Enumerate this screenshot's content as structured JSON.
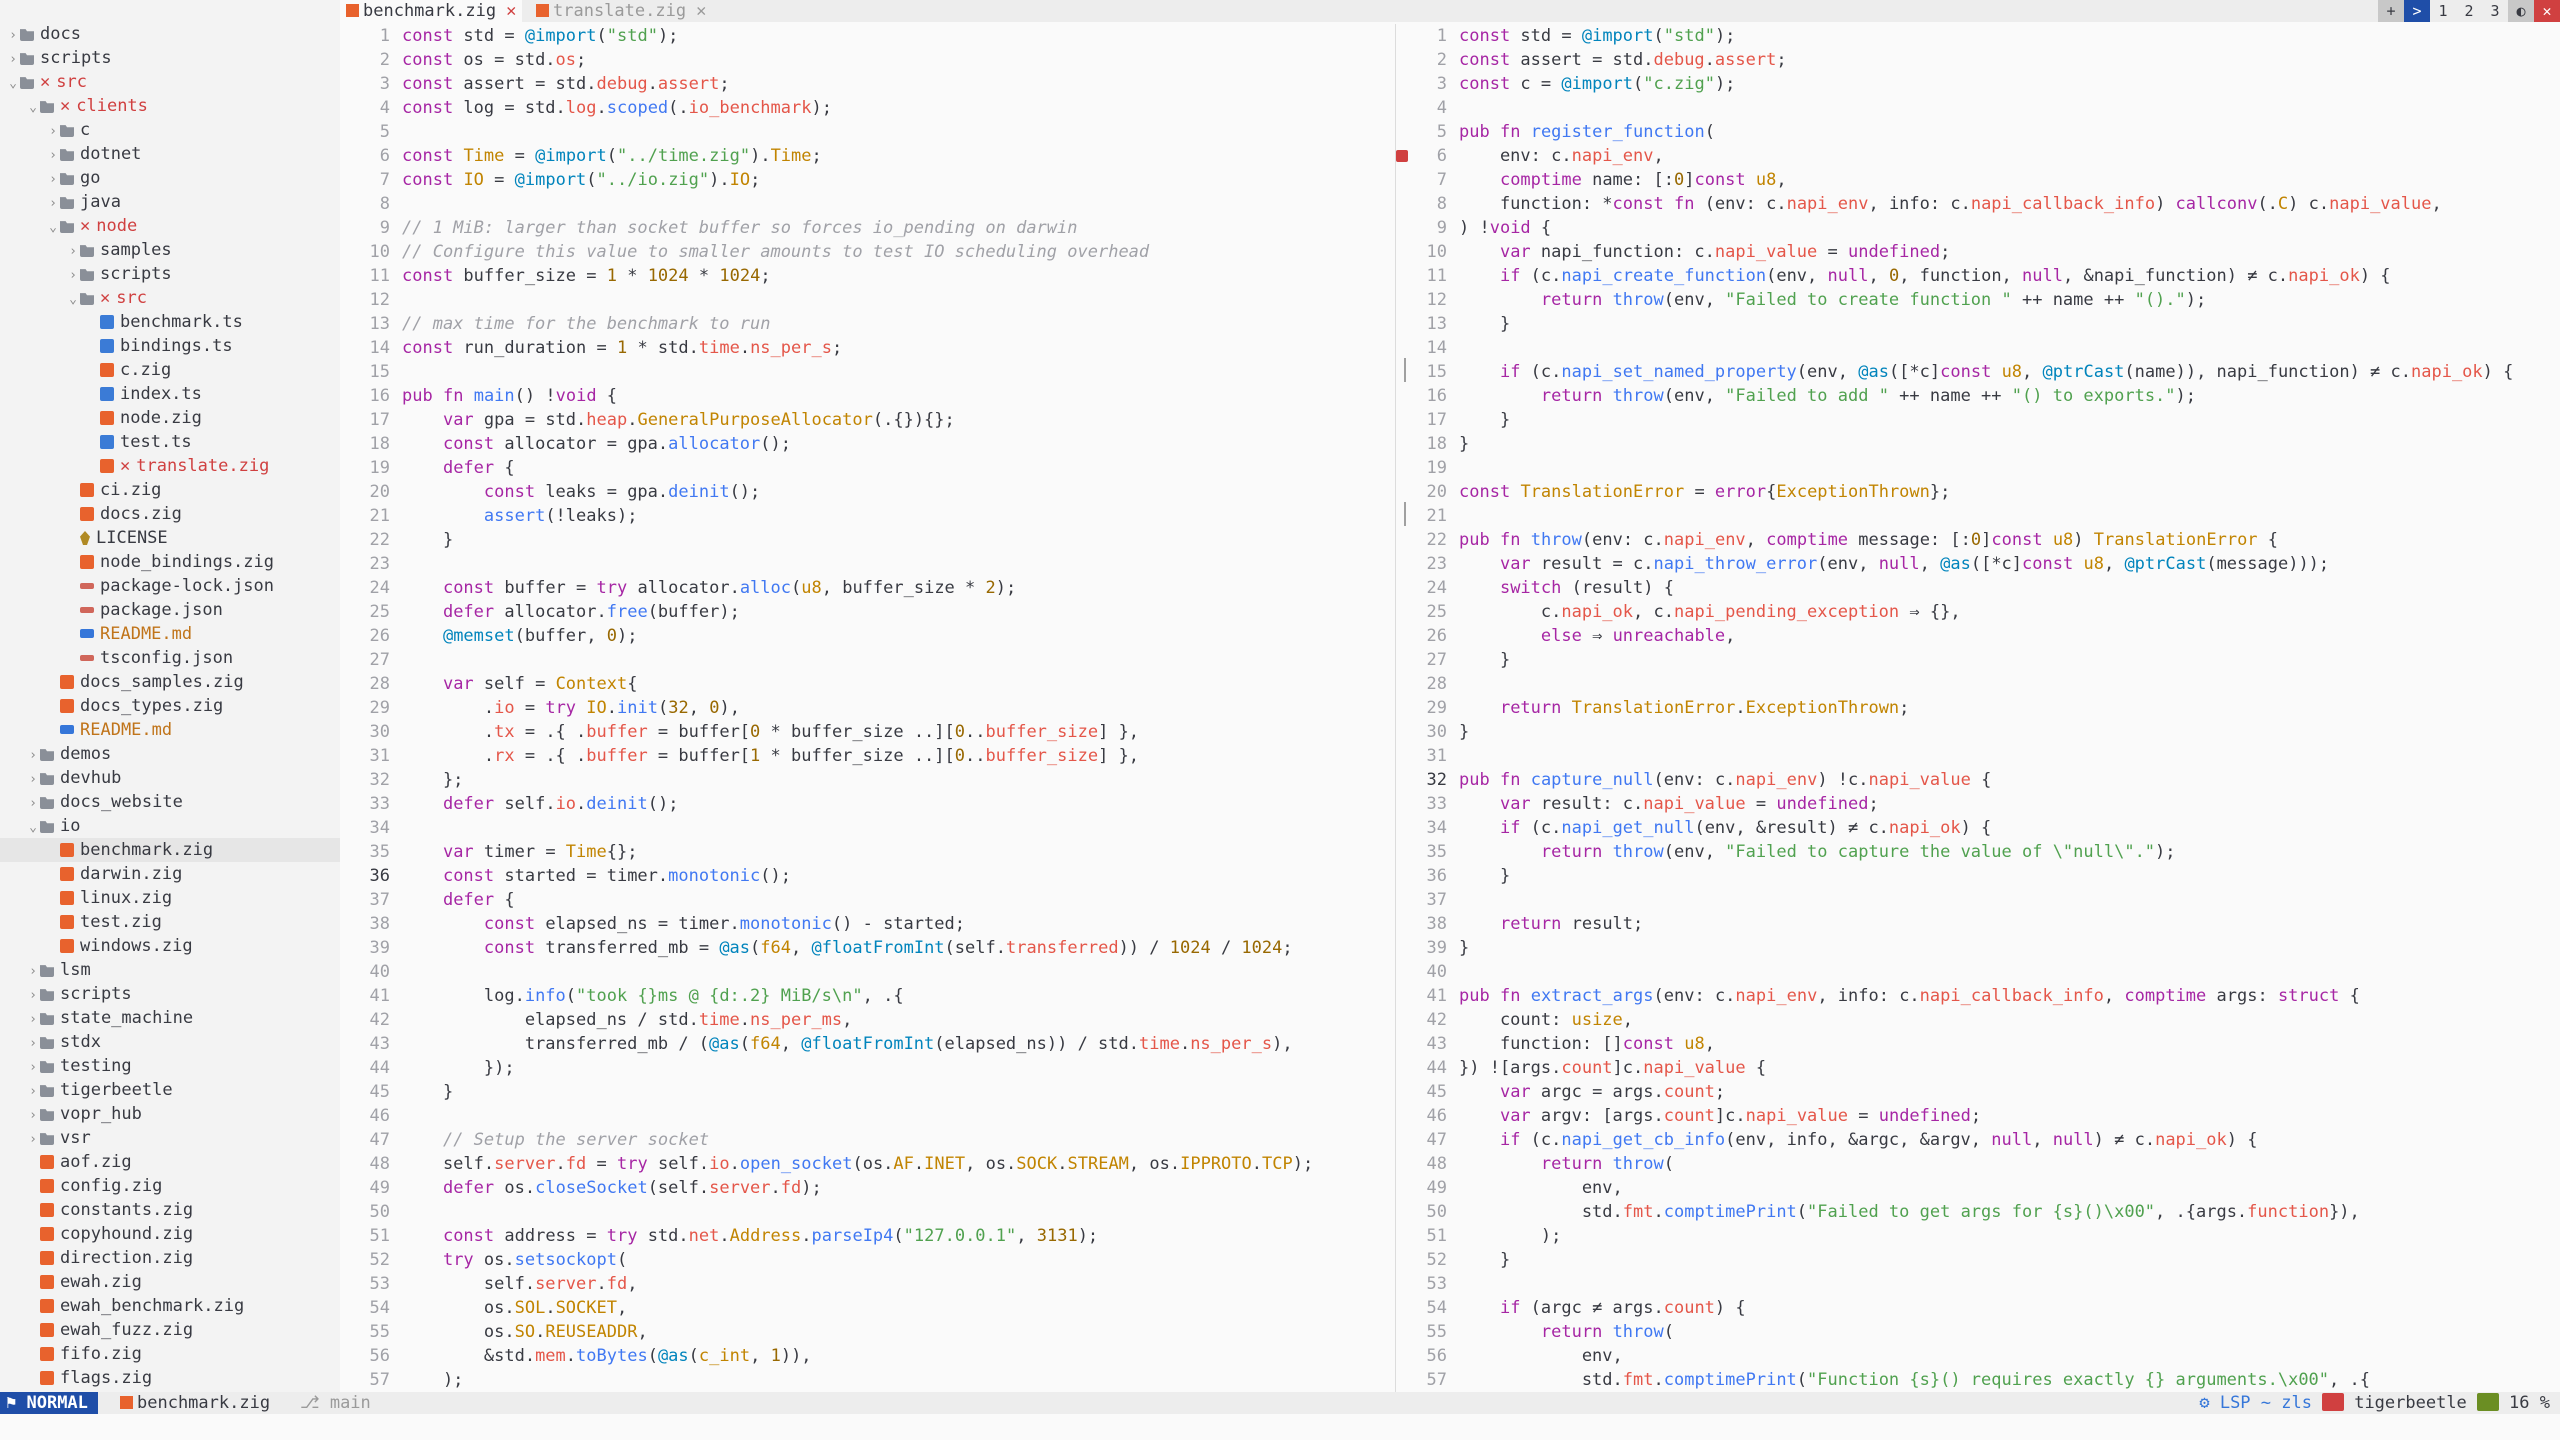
{
  "tabs": [
    {
      "label": "benchmark.zig",
      "active": true
    },
    {
      "label": "translate.zig",
      "active": false
    }
  ],
  "tab_controls": [
    "+",
    ">",
    "1",
    "2",
    "3",
    "◐",
    "✕"
  ],
  "sidebar": [
    {
      "label": "docs",
      "depth": 0,
      "kind": "folder",
      "open": false
    },
    {
      "label": "scripts",
      "depth": 0,
      "kind": "folder",
      "open": false
    },
    {
      "label": "src",
      "depth": 0,
      "kind": "folder",
      "open": true,
      "state": "err"
    },
    {
      "label": "clients",
      "depth": 1,
      "kind": "folder",
      "open": true,
      "state": "err"
    },
    {
      "label": "c",
      "depth": 2,
      "kind": "folder",
      "open": false
    },
    {
      "label": "dotnet",
      "depth": 2,
      "kind": "folder",
      "open": false
    },
    {
      "label": "go",
      "depth": 2,
      "kind": "folder",
      "open": false
    },
    {
      "label": "java",
      "depth": 2,
      "kind": "folder",
      "open": false
    },
    {
      "label": "node",
      "depth": 2,
      "kind": "folder",
      "open": true,
      "state": "err"
    },
    {
      "label": "samples",
      "depth": 3,
      "kind": "folder",
      "open": false
    },
    {
      "label": "scripts",
      "depth": 3,
      "kind": "folder",
      "open": false
    },
    {
      "label": "src",
      "depth": 3,
      "kind": "folder",
      "open": true,
      "state": "err"
    },
    {
      "label": "benchmark.ts",
      "depth": 4,
      "kind": "ts"
    },
    {
      "label": "bindings.ts",
      "depth": 4,
      "kind": "ts"
    },
    {
      "label": "c.zig",
      "depth": 4,
      "kind": "zig"
    },
    {
      "label": "index.ts",
      "depth": 4,
      "kind": "ts"
    },
    {
      "label": "node.zig",
      "depth": 4,
      "kind": "zig"
    },
    {
      "label": "test.ts",
      "depth": 4,
      "kind": "ts"
    },
    {
      "label": "translate.zig",
      "depth": 4,
      "kind": "zig",
      "state": "err"
    },
    {
      "label": "ci.zig",
      "depth": 3,
      "kind": "zig"
    },
    {
      "label": "docs.zig",
      "depth": 3,
      "kind": "zig"
    },
    {
      "label": "LICENSE",
      "depth": 3,
      "kind": "lic"
    },
    {
      "label": "node_bindings.zig",
      "depth": 3,
      "kind": "zig"
    },
    {
      "label": "package-lock.json",
      "depth": 3,
      "kind": "json"
    },
    {
      "label": "package.json",
      "depth": 3,
      "kind": "json"
    },
    {
      "label": "README.md",
      "depth": 3,
      "kind": "md",
      "state": "warn"
    },
    {
      "label": "tsconfig.json",
      "depth": 3,
      "kind": "json"
    },
    {
      "label": "docs_samples.zig",
      "depth": 2,
      "kind": "zig"
    },
    {
      "label": "docs_types.zig",
      "depth": 2,
      "kind": "zig"
    },
    {
      "label": "README.md",
      "depth": 2,
      "kind": "md",
      "state": "warn"
    },
    {
      "label": "demos",
      "depth": 1,
      "kind": "folder",
      "open": false
    },
    {
      "label": "devhub",
      "depth": 1,
      "kind": "folder",
      "open": false
    },
    {
      "label": "docs_website",
      "depth": 1,
      "kind": "folder",
      "open": false
    },
    {
      "label": "io",
      "depth": 1,
      "kind": "folder",
      "open": true
    },
    {
      "label": "benchmark.zig",
      "depth": 2,
      "kind": "zig",
      "active": true
    },
    {
      "label": "darwin.zig",
      "depth": 2,
      "kind": "zig"
    },
    {
      "label": "linux.zig",
      "depth": 2,
      "kind": "zig"
    },
    {
      "label": "test.zig",
      "depth": 2,
      "kind": "zig"
    },
    {
      "label": "windows.zig",
      "depth": 2,
      "kind": "zig"
    },
    {
      "label": "lsm",
      "depth": 1,
      "kind": "folder",
      "open": false
    },
    {
      "label": "scripts",
      "depth": 1,
      "kind": "folder",
      "open": false
    },
    {
      "label": "state_machine",
      "depth": 1,
      "kind": "folder",
      "open": false
    },
    {
      "label": "stdx",
      "depth": 1,
      "kind": "folder",
      "open": false
    },
    {
      "label": "testing",
      "depth": 1,
      "kind": "folder",
      "open": false
    },
    {
      "label": "tigerbeetle",
      "depth": 1,
      "kind": "folder",
      "open": false
    },
    {
      "label": "vopr_hub",
      "depth": 1,
      "kind": "folder",
      "open": false
    },
    {
      "label": "vsr",
      "depth": 1,
      "kind": "folder",
      "open": false
    },
    {
      "label": "aof.zig",
      "depth": 1,
      "kind": "zig"
    },
    {
      "label": "config.zig",
      "depth": 1,
      "kind": "zig"
    },
    {
      "label": "constants.zig",
      "depth": 1,
      "kind": "zig"
    },
    {
      "label": "copyhound.zig",
      "depth": 1,
      "kind": "zig"
    },
    {
      "label": "direction.zig",
      "depth": 1,
      "kind": "zig"
    },
    {
      "label": "ewah.zig",
      "depth": 1,
      "kind": "zig"
    },
    {
      "label": "ewah_benchmark.zig",
      "depth": 1,
      "kind": "zig"
    },
    {
      "label": "ewah_fuzz.zig",
      "depth": 1,
      "kind": "zig"
    },
    {
      "label": "fifo.zig",
      "depth": 1,
      "kind": "zig"
    },
    {
      "label": "flags.zig",
      "depth": 1,
      "kind": "zig"
    }
  ],
  "left_editor": {
    "current_line": 36,
    "lines": [
      "const std = @import(\"std\");",
      "const os = std.os;",
      "const assert = std.debug.assert;",
      "const log = std.log.scoped(.io_benchmark);",
      "",
      "const Time = @import(\"../time.zig\").Time;",
      "const IO = @import(\"../io.zig\").IO;",
      "",
      "// 1 MiB: larger than socket buffer so forces io_pending on darwin",
      "// Configure this value to smaller amounts to test IO scheduling overhead",
      "const buffer_size = 1 * 1024 * 1024;",
      "",
      "// max time for the benchmark to run",
      "const run_duration = 1 * std.time.ns_per_s;",
      "",
      "pub fn main() !void {",
      "    var gpa = std.heap.GeneralPurposeAllocator(.{}){};",
      "    const allocator = gpa.allocator();",
      "    defer {",
      "        const leaks = gpa.deinit();",
      "        assert(!leaks);",
      "    }",
      "",
      "    const buffer = try allocator.alloc(u8, buffer_size * 2);",
      "    defer allocator.free(buffer);",
      "    @memset(buffer, 0);",
      "",
      "    var self = Context{",
      "        .io = try IO.init(32, 0),",
      "        .tx = .{ .buffer = buffer[0 * buffer_size ..][0..buffer_size] },",
      "        .rx = .{ .buffer = buffer[1 * buffer_size ..][0..buffer_size] },",
      "    };",
      "    defer self.io.deinit();",
      "",
      "    var timer = Time{};",
      "    const started = timer.monotonic();",
      "    defer {",
      "        const elapsed_ns = timer.monotonic() - started;",
      "        const transferred_mb = @as(f64, @floatFromInt(self.transferred)) / 1024 / 1024;",
      "",
      "        log.info(\"took {}ms @ {d:.2} MiB/s\\n\", .{",
      "            elapsed_ns / std.time.ns_per_ms,",
      "            transferred_mb / (@as(f64, @floatFromInt(elapsed_ns)) / std.time.ns_per_s),",
      "        });",
      "    }",
      "",
      "    // Setup the server socket",
      "    self.server.fd = try self.io.open_socket(os.AF.INET, os.SOCK.STREAM, os.IPPROTO.TCP);",
      "    defer os.closeSocket(self.server.fd);",
      "",
      "    const address = try std.net.Address.parseIp4(\"127.0.0.1\", 3131);",
      "    try os.setsockopt(",
      "        self.server.fd,",
      "        os.SOL.SOCKET,",
      "        os.SO.REUSEADDR,",
      "        &std.mem.toBytes(@as(c_int, 1)),",
      "    );"
    ]
  },
  "right_editor": {
    "current_line": 32,
    "lines": [
      "const std = @import(\"std\");",
      "const assert = std.debug.assert;",
      "const c = @import(\"c.zig\");",
      "",
      "pub fn register_function(",
      "    env: c.napi_env,",
      "    comptime name: [:0]const u8,",
      "    function: *const fn (env: c.napi_env, info: c.napi_callback_info) callconv(.C) c.napi_value,",
      ") !void {",
      "    var napi_function: c.napi_value = undefined;",
      "    if (c.napi_create_function(env, null, 0, function, null, &napi_function) ≠ c.napi_ok) {",
      "        return throw(env, \"Failed to create function \" ++ name ++ \"().\");",
      "    }",
      "",
      "    if (c.napi_set_named_property(env, @as([*c]const u8, @ptrCast(name)), napi_function) ≠ c.napi_ok) {",
      "        return throw(env, \"Failed to add \" ++ name ++ \"() to exports.\");",
      "    }",
      "}",
      "",
      "const TranslationError = error{ExceptionThrown};",
      "",
      "pub fn throw(env: c.napi_env, comptime message: [:0]const u8) TranslationError {",
      "    var result = c.napi_throw_error(env, null, @as([*c]const u8, @ptrCast(message)));",
      "    switch (result) {",
      "        c.napi_ok, c.napi_pending_exception ⇒ {},",
      "        else ⇒ unreachable,",
      "    }",
      "",
      "    return TranslationError.ExceptionThrown;",
      "}",
      "",
      "pub fn capture_null(env: c.napi_env) !c.napi_value {",
      "    var result: c.napi_value = undefined;",
      "    if (c.napi_get_null(env, &result) ≠ c.napi_ok) {",
      "        return throw(env, \"Failed to capture the value of \\\"null\\\".\");",
      "    }",
      "",
      "    return result;",
      "}",
      "",
      "pub fn extract_args(env: c.napi_env, info: c.napi_callback_info, comptime args: struct {",
      "    count: usize,",
      "    function: []const u8,",
      "}) ![args.count]c.napi_value {",
      "    var argc = args.count;",
      "    var argv: [args.count]c.napi_value = undefined;",
      "    if (c.napi_get_cb_info(env, info, &argc, &argv, null, null) ≠ c.napi_ok) {",
      "        return throw(",
      "            env,",
      "            std.fmt.comptimePrint(\"Failed to get args for {s}()\\x00\", .{args.function}),",
      "        );",
      "    }",
      "",
      "    if (argc ≠ args.count) {",
      "        return throw(",
      "            env,",
      "            std.fmt.comptimePrint(\"Function {s}() requires exactly {} arguments.\\x00\", .{"
    ]
  },
  "status": {
    "mode": "NORMAL",
    "file": "benchmark.zig",
    "branch": "main",
    "lsp": "LSP ~ zls",
    "project": "tigerbeetle",
    "percent": "16 %"
  },
  "colors": {
    "accent": "#1f4ea8",
    "error": "#d04040",
    "zig_icon": "#e8622d"
  }
}
